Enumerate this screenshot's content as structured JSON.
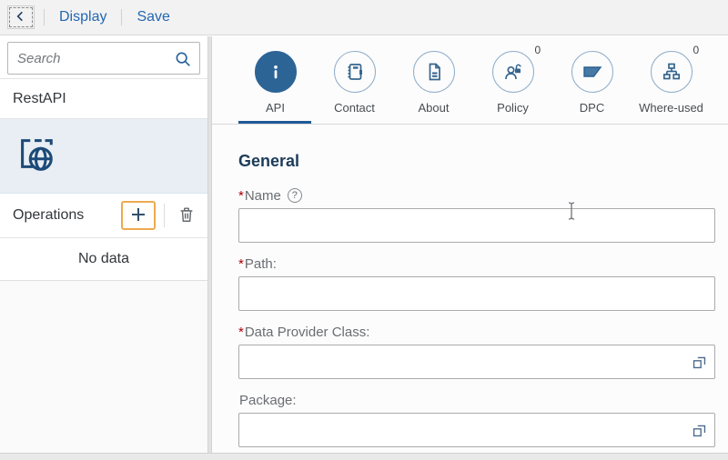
{
  "topbar": {
    "display_label": "Display",
    "save_label": "Save"
  },
  "sidebar": {
    "search_placeholder": "Search",
    "search_value": "",
    "root_item_label": "RestAPI",
    "selected_item_icon": "browser-globe-icon",
    "operations_label": "Operations",
    "empty_text": "No data"
  },
  "tabs": [
    {
      "label": "API",
      "icon": "info-icon",
      "selected": true
    },
    {
      "label": "Contact",
      "icon": "contact-book-icon",
      "selected": false
    },
    {
      "label": "About",
      "icon": "document-icon",
      "selected": false
    },
    {
      "label": "Policy",
      "icon": "person-lock-icon",
      "selected": false,
      "count": "0"
    },
    {
      "label": "DPC",
      "icon": "trapezoid-icon",
      "selected": false
    },
    {
      "label": "Where-used",
      "icon": "org-chart-icon",
      "selected": false,
      "count": "0"
    }
  ],
  "form": {
    "section_title": "General",
    "help_icon_glyph": "?",
    "fields": [
      {
        "label": "Name",
        "required_mark": "*",
        "value": "",
        "has_help": true,
        "has_value_help": false
      },
      {
        "label": "Path:",
        "required_mark": "*",
        "value": "",
        "has_help": false,
        "has_value_help": false
      },
      {
        "label": "Data Provider Class:",
        "required_mark": "*",
        "value": "",
        "has_help": false,
        "has_value_help": true
      },
      {
        "label": "Package:",
        "required_mark": "",
        "value": "",
        "has_help": false,
        "has_value_help": true
      }
    ]
  },
  "icons": {
    "back": "chevron-left",
    "search": "magnifier",
    "add": "plus",
    "delete": "trash",
    "value_help": "overlapping-squares"
  },
  "colors": {
    "accent_blue": "#2368b0",
    "selected_tab_fill": "#2d6496",
    "tab_underline": "#1f5a96",
    "focus_orange": "#edaa4e",
    "required_red": "#b00000",
    "selected_row_bg": "#e8eef4",
    "topbar_bg": "#f2f2f3"
  }
}
